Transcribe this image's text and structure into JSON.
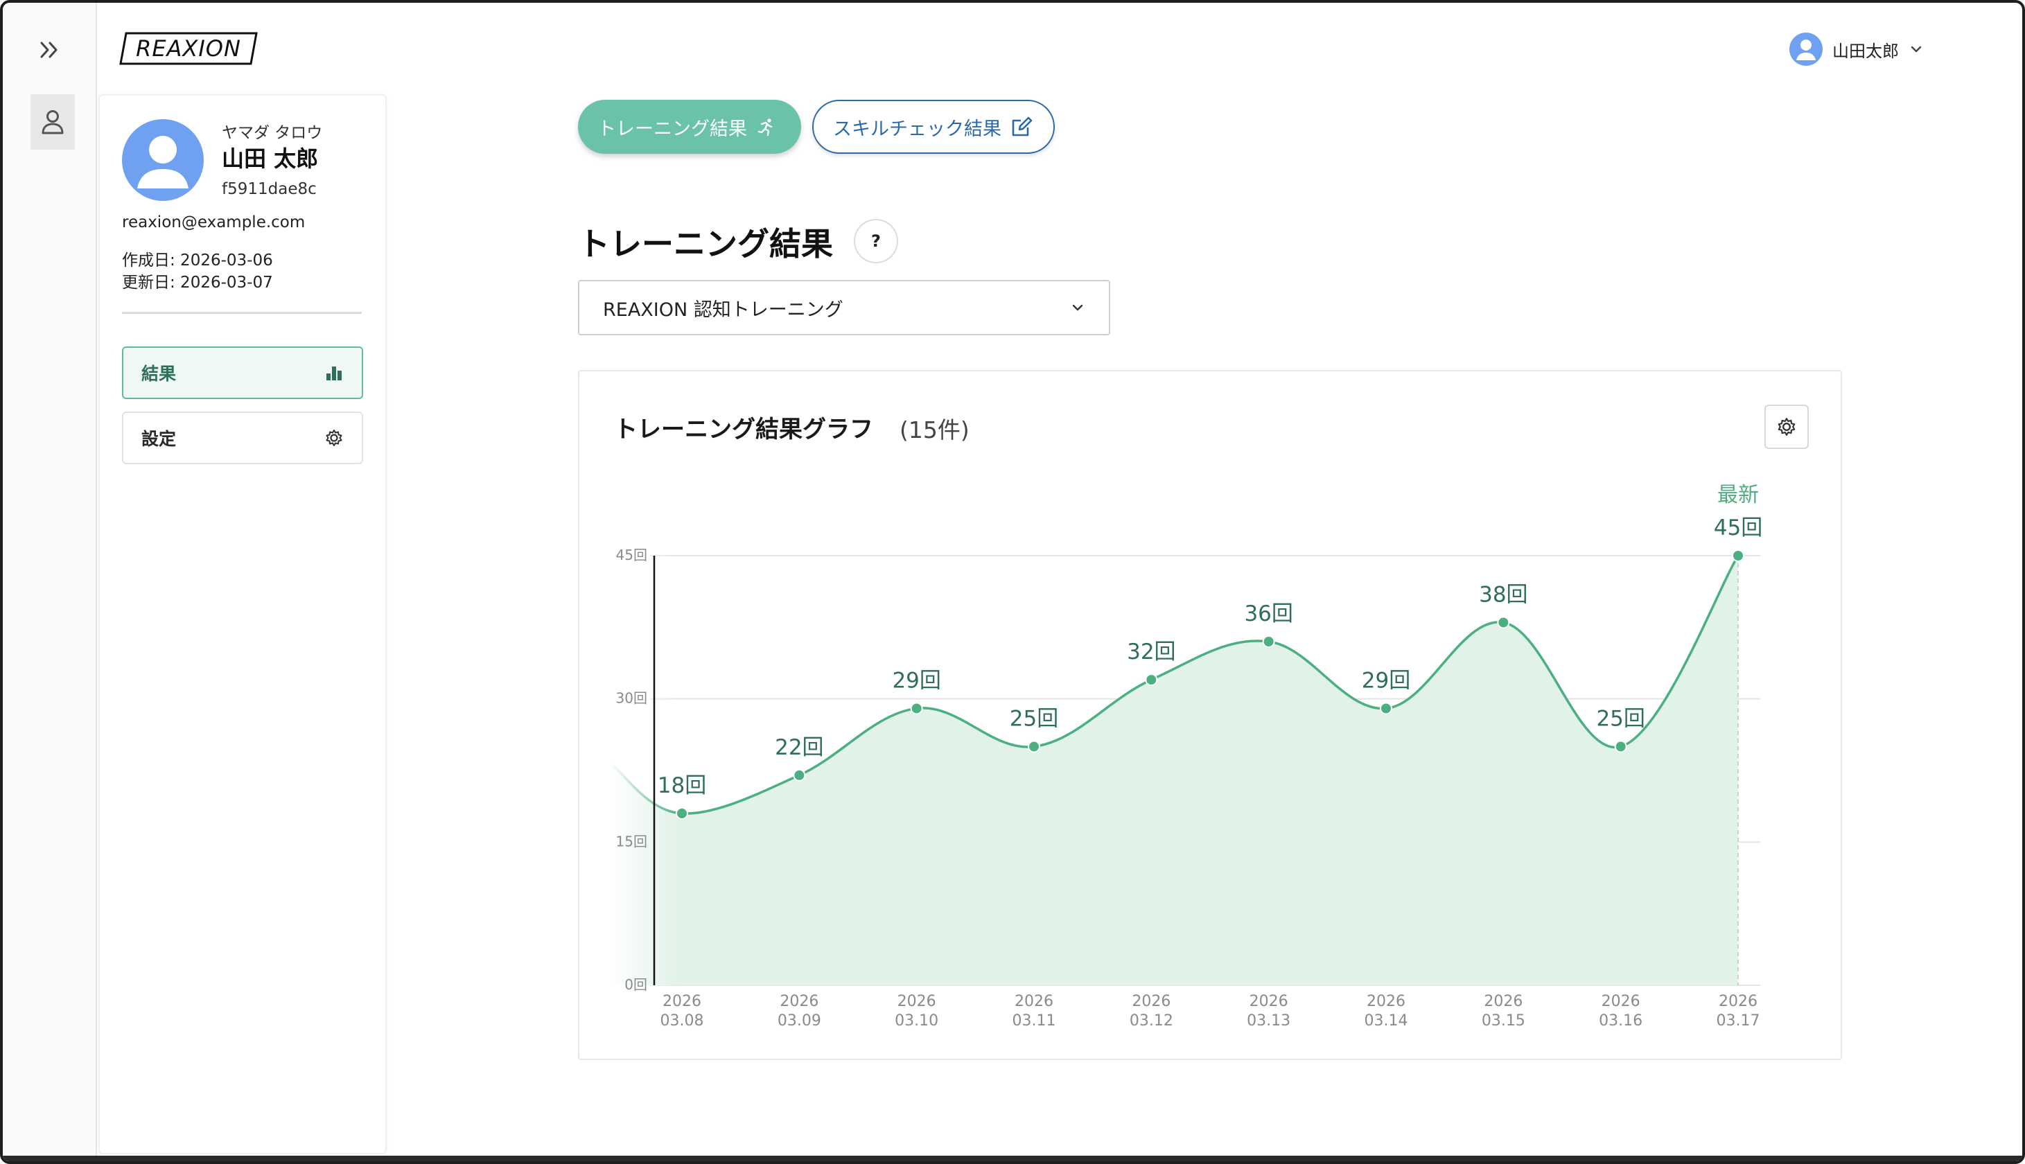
{
  "header": {
    "logo_text": "REAXION",
    "user_name": "山田太郎"
  },
  "profile": {
    "kana": "ヤマダ タロウ",
    "name": "山田 太郎",
    "id": "f5911dae8c",
    "email": "reaxion@example.com",
    "created": "作成日: 2026-03-06",
    "updated": "更新日: 2026-03-07",
    "nav": [
      {
        "label": "結果",
        "icon": "bar-chart-icon",
        "active": true
      },
      {
        "label": "設定",
        "icon": "gear-icon",
        "active": false
      }
    ]
  },
  "tabs": {
    "training_label": "トレーニング結果",
    "skill_label": "スキルチェック結果"
  },
  "main": {
    "title": "トレーニング結果",
    "help_label": "?",
    "select_value": "REAXION 認知トレーニング"
  },
  "card": {
    "title": "トレーニング結果グラフ",
    "count": "(15件)"
  },
  "colors": {
    "accent": "#4caf80",
    "accent_dark": "#2f6f59",
    "tab_active": "#6ac3a8",
    "link_blue": "#2b6aa8",
    "avatar": "#6fa1f0"
  },
  "chart_data": {
    "type": "area",
    "x": [
      "2026\n03.08",
      "2026\n03.09",
      "2026\n03.10",
      "2026\n03.11",
      "2026\n03.12",
      "2026\n03.13",
      "2026\n03.14",
      "2026\n03.15",
      "2026\n03.16",
      "2026\n03.17"
    ],
    "x_top": [
      "2026",
      "2026",
      "2026",
      "2026",
      "2026",
      "2026",
      "2026",
      "2026",
      "2026",
      "2026"
    ],
    "x_bottom": [
      "03.08",
      "03.09",
      "03.10",
      "03.11",
      "03.12",
      "03.13",
      "03.14",
      "03.15",
      "03.16",
      "03.17"
    ],
    "values": [
      18,
      22,
      29,
      25,
      32,
      36,
      29,
      38,
      25,
      45
    ],
    "point_labels": [
      "18回",
      "22回",
      "29回",
      "25回",
      "32回",
      "36回",
      "29回",
      "38回",
      "25回",
      "45回"
    ],
    "yticks": [
      0,
      15,
      30,
      45
    ],
    "ytick_labels": [
      "0回",
      "15回",
      "30回",
      "45回"
    ],
    "ylim": [
      0,
      45
    ],
    "latest_label": "最新",
    "grid": true
  }
}
